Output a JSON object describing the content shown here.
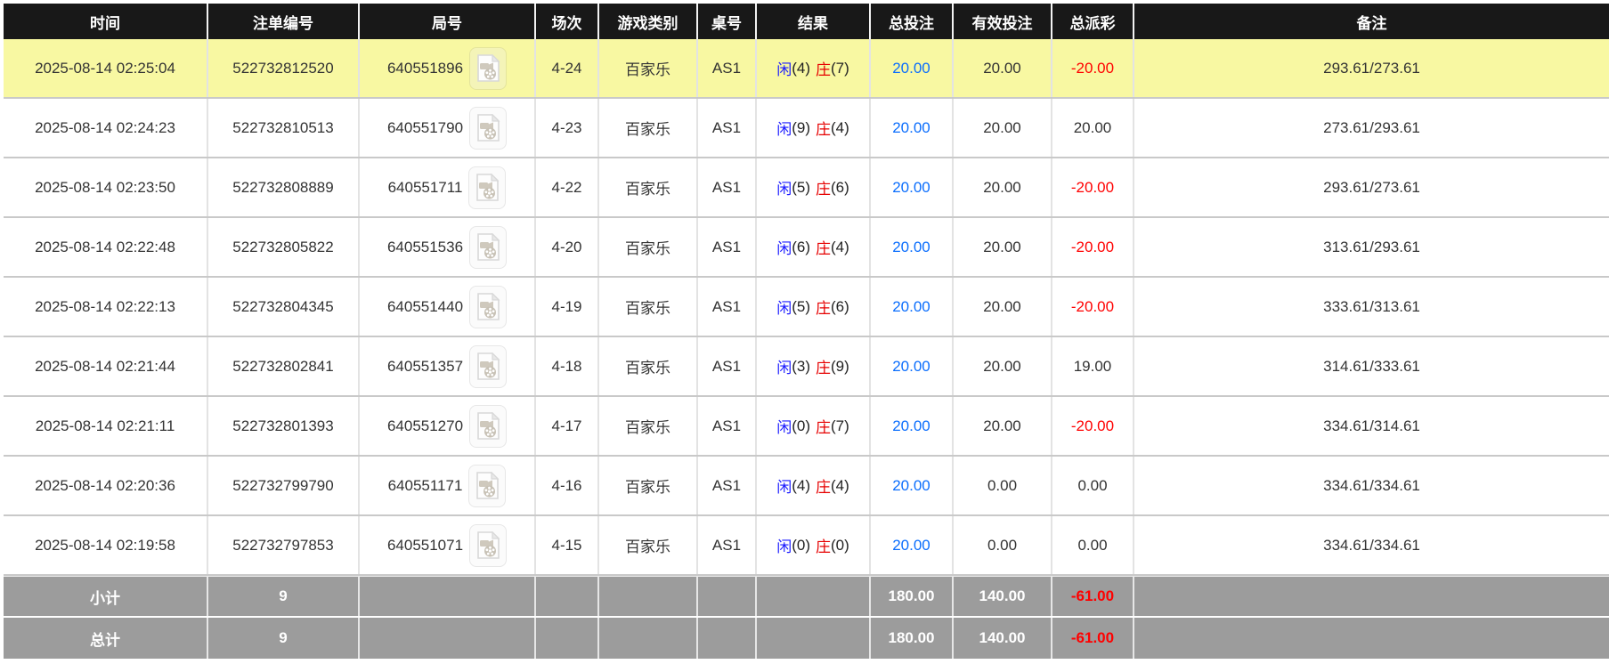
{
  "table": {
    "columns": [
      "时间",
      "注单编号",
      "局号",
      "场次",
      "游戏类别",
      "桌号",
      "结果",
      "总投注",
      "有效投注",
      "总派彩",
      "备注"
    ],
    "icons": {
      "video": "video-file-icon"
    },
    "colors": {
      "header_bg": "#181818",
      "highlight_row": "#f8f8a2",
      "footer_bg": "#9c9c9c",
      "total_bet_blue": "#0b6efd",
      "player_blue": "#1a1aff",
      "banker_red": "#e60000",
      "loss_red": "#ff0000"
    },
    "rows": [
      {
        "time": "2025-08-14 02:25:04",
        "bet_id": "522732812520",
        "round_id": "640551896",
        "session": "4-24",
        "game": "百家乐",
        "table": "AS1",
        "player_label": "闲",
        "player_score": "(4)",
        "banker_label": "庄",
        "banker_score": "(7)",
        "total_bet": "20.00",
        "valid_bet": "20.00",
        "payout": "-20.00",
        "remark": "293.61/273.61",
        "highlighted": true
      },
      {
        "time": "2025-08-14 02:24:23",
        "bet_id": "522732810513",
        "round_id": "640551790",
        "session": "4-23",
        "game": "百家乐",
        "table": "AS1",
        "player_label": "闲",
        "player_score": "(9)",
        "banker_label": "庄",
        "banker_score": "(4)",
        "total_bet": "20.00",
        "valid_bet": "20.00",
        "payout": "20.00",
        "remark": "273.61/293.61",
        "highlighted": false
      },
      {
        "time": "2025-08-14 02:23:50",
        "bet_id": "522732808889",
        "round_id": "640551711",
        "session": "4-22",
        "game": "百家乐",
        "table": "AS1",
        "player_label": "闲",
        "player_score": "(5)",
        "banker_label": "庄",
        "banker_score": "(6)",
        "total_bet": "20.00",
        "valid_bet": "20.00",
        "payout": "-20.00",
        "remark": "293.61/273.61",
        "highlighted": false
      },
      {
        "time": "2025-08-14 02:22:48",
        "bet_id": "522732805822",
        "round_id": "640551536",
        "session": "4-20",
        "game": "百家乐",
        "table": "AS1",
        "player_label": "闲",
        "player_score": "(6)",
        "banker_label": "庄",
        "banker_score": "(4)",
        "total_bet": "20.00",
        "valid_bet": "20.00",
        "payout": "-20.00",
        "remark": "313.61/293.61",
        "highlighted": false
      },
      {
        "time": "2025-08-14 02:22:13",
        "bet_id": "522732804345",
        "round_id": "640551440",
        "session": "4-19",
        "game": "百家乐",
        "table": "AS1",
        "player_label": "闲",
        "player_score": "(5)",
        "banker_label": "庄",
        "banker_score": "(6)",
        "total_bet": "20.00",
        "valid_bet": "20.00",
        "payout": "-20.00",
        "remark": "333.61/313.61",
        "highlighted": false
      },
      {
        "time": "2025-08-14 02:21:44",
        "bet_id": "522732802841",
        "round_id": "640551357",
        "session": "4-18",
        "game": "百家乐",
        "table": "AS1",
        "player_label": "闲",
        "player_score": "(3)",
        "banker_label": "庄",
        "banker_score": "(9)",
        "total_bet": "20.00",
        "valid_bet": "20.00",
        "payout": "19.00",
        "remark": "314.61/333.61",
        "highlighted": false
      },
      {
        "time": "2025-08-14 02:21:11",
        "bet_id": "522732801393",
        "round_id": "640551270",
        "session": "4-17",
        "game": "百家乐",
        "table": "AS1",
        "player_label": "闲",
        "player_score": "(0)",
        "banker_label": "庄",
        "banker_score": "(7)",
        "total_bet": "20.00",
        "valid_bet": "20.00",
        "payout": "-20.00",
        "remark": "334.61/314.61",
        "highlighted": false
      },
      {
        "time": "2025-08-14 02:20:36",
        "bet_id": "522732799790",
        "round_id": "640551171",
        "session": "4-16",
        "game": "百家乐",
        "table": "AS1",
        "player_label": "闲",
        "player_score": "(4)",
        "banker_label": "庄",
        "banker_score": "(4)",
        "total_bet": "20.00",
        "valid_bet": "0.00",
        "payout": "0.00",
        "remark": "334.61/334.61",
        "highlighted": false
      },
      {
        "time": "2025-08-14 02:19:58",
        "bet_id": "522732797853",
        "round_id": "640551071",
        "session": "4-15",
        "game": "百家乐",
        "table": "AS1",
        "player_label": "闲",
        "player_score": "(0)",
        "banker_label": "庄",
        "banker_score": "(0)",
        "total_bet": "20.00",
        "valid_bet": "0.00",
        "payout": "0.00",
        "remark": "334.61/334.61",
        "highlighted": false
      }
    ],
    "footer": {
      "subtotal": {
        "label": "小计",
        "count": "9",
        "total_bet": "180.00",
        "valid_bet": "140.00",
        "payout": "-61.00"
      },
      "total": {
        "label": "总计",
        "count": "9",
        "total_bet": "180.00",
        "valid_bet": "140.00",
        "payout": "-61.00"
      }
    }
  }
}
